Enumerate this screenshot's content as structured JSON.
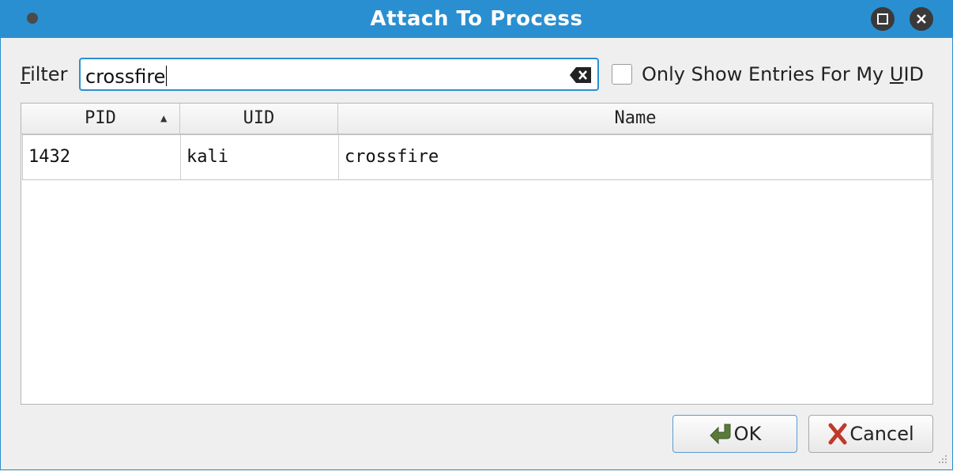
{
  "window": {
    "title": "Attach To Process"
  },
  "filter": {
    "label_mnemonic": "F",
    "label_rest": "ilter",
    "value": "crossfire",
    "clear_icon": "backspace-clear-icon"
  },
  "uid_option": {
    "label_before": "Only Show Entries For My ",
    "label_mnemonic": "U",
    "label_after": "ID",
    "checked": false
  },
  "table": {
    "columns": [
      "PID",
      "UID",
      "Name"
    ],
    "sorted_column": "PID",
    "sort_direction": "ascending",
    "rows": [
      {
        "pid": "1432",
        "uid": "kali",
        "name": "crossfire"
      }
    ]
  },
  "buttons": {
    "ok_label": "OK",
    "ok_icon": "checkmark-arrow-icon",
    "cancel_label": "Cancel",
    "cancel_icon": "red-x-icon"
  },
  "colors": {
    "titlebar": "#2a8fd0",
    "accent": "#2a8fd0"
  }
}
